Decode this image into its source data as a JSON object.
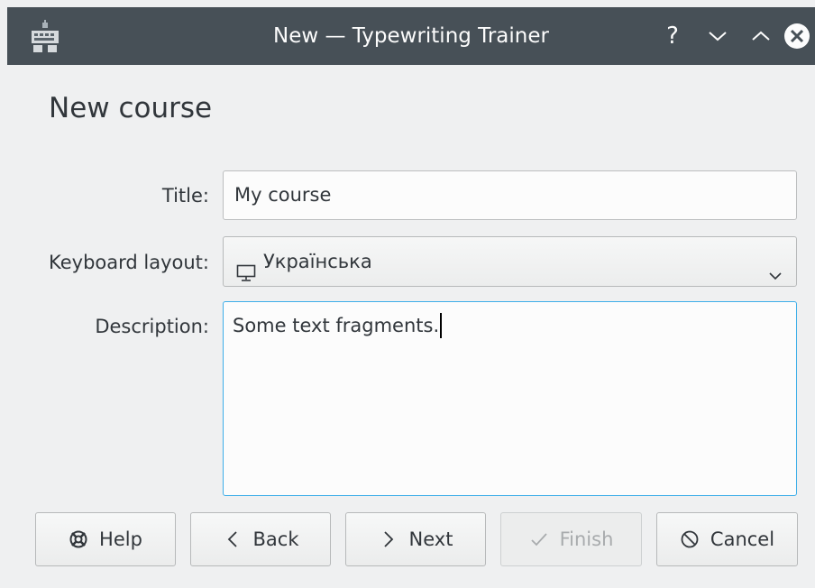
{
  "window": {
    "title": "New — Typewriting Trainer",
    "help_glyph": "?"
  },
  "page": {
    "heading": "New course"
  },
  "form": {
    "title_label": "Title:",
    "title_value": "My course",
    "layout_label": "Keyboard layout:",
    "layout_value": "Українська",
    "description_label": "Description:",
    "description_value": "Some text fragments."
  },
  "buttons": {
    "help": "Help",
    "back": "Back",
    "next": "Next",
    "finish": "Finish",
    "cancel": "Cancel"
  },
  "colors": {
    "titlebar": "#475057",
    "focus_border": "#3daee9",
    "background": "#eff0f1"
  }
}
